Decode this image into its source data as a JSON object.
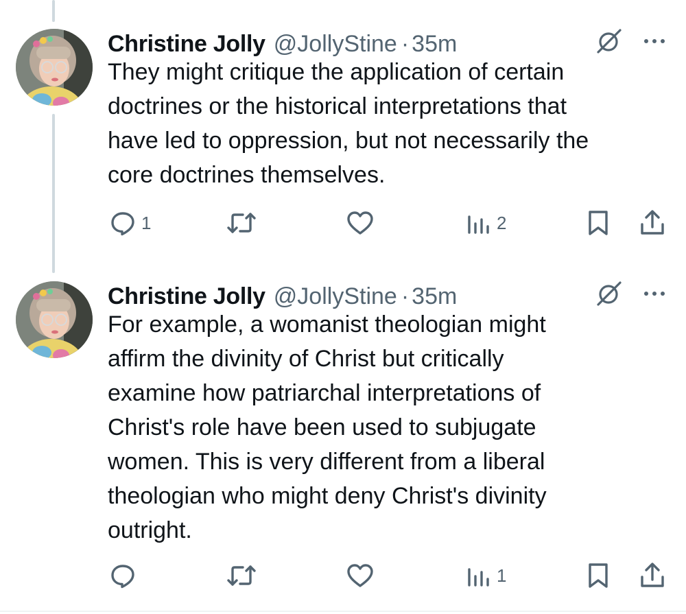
{
  "tweets": [
    {
      "author": {
        "name": "Christine Jolly",
        "handle": "@JollyStine",
        "separator": "·",
        "time": "35m"
      },
      "text_lines": [
        "They might critique the application of certain",
        "doctrines or the historical interpretations that",
        "have led to oppression, but not necessarily the",
        "core doctrines themselves."
      ],
      "actions": {
        "reply_count": "1",
        "retweet_count": "",
        "like_count": "",
        "views_count": "2"
      }
    },
    {
      "author": {
        "name": "Christine Jolly",
        "handle": "@JollyStine",
        "separator": "·",
        "time": "35m"
      },
      "text_lines": [
        "For example, a womanist theologian might",
        "affirm the divinity of Christ but critically",
        "examine how patriarchal interpretations of",
        "Christ's role have been used to subjugate",
        "women. This is very different from a liberal",
        "theologian who might deny Christ's divinity",
        "outright."
      ],
      "actions": {
        "reply_count": "",
        "retweet_count": "",
        "like_count": "",
        "views_count": "1"
      }
    }
  ],
  "icons": {
    "grok": "grok-icon",
    "more": "more-icon",
    "reply": "reply-icon",
    "retweet": "retweet-icon",
    "like": "like-icon",
    "views": "views-icon",
    "bookmark": "bookmark-icon",
    "share": "share-icon"
  },
  "colors": {
    "text_primary": "#0f1419",
    "text_secondary": "#536471",
    "thread_line": "#cfd9de",
    "background": "#ffffff"
  }
}
